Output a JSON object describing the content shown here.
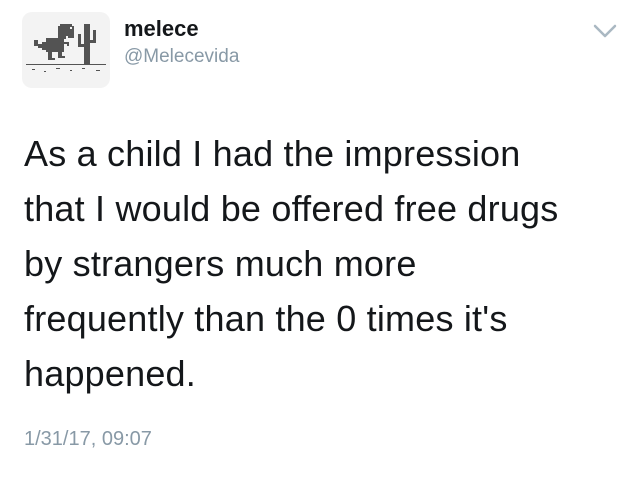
{
  "tweet": {
    "author": {
      "display_name": "melece",
      "handle": "@Melecevida",
      "avatar_icon": "pixel-dinosaur-icon"
    },
    "menu_icon": "chevron-down-icon",
    "text": "As a child I had the impression\nthat I would be offered free drugs\nby strangers much more\nfrequently than the 0 times it's\nhappened.",
    "timestamp": "1/31/17, 09:07"
  },
  "colors": {
    "text": "#14171a",
    "secondary": "#8899a6",
    "avatar_background": "#f3f3f3",
    "avatar_ink": "#535353"
  }
}
